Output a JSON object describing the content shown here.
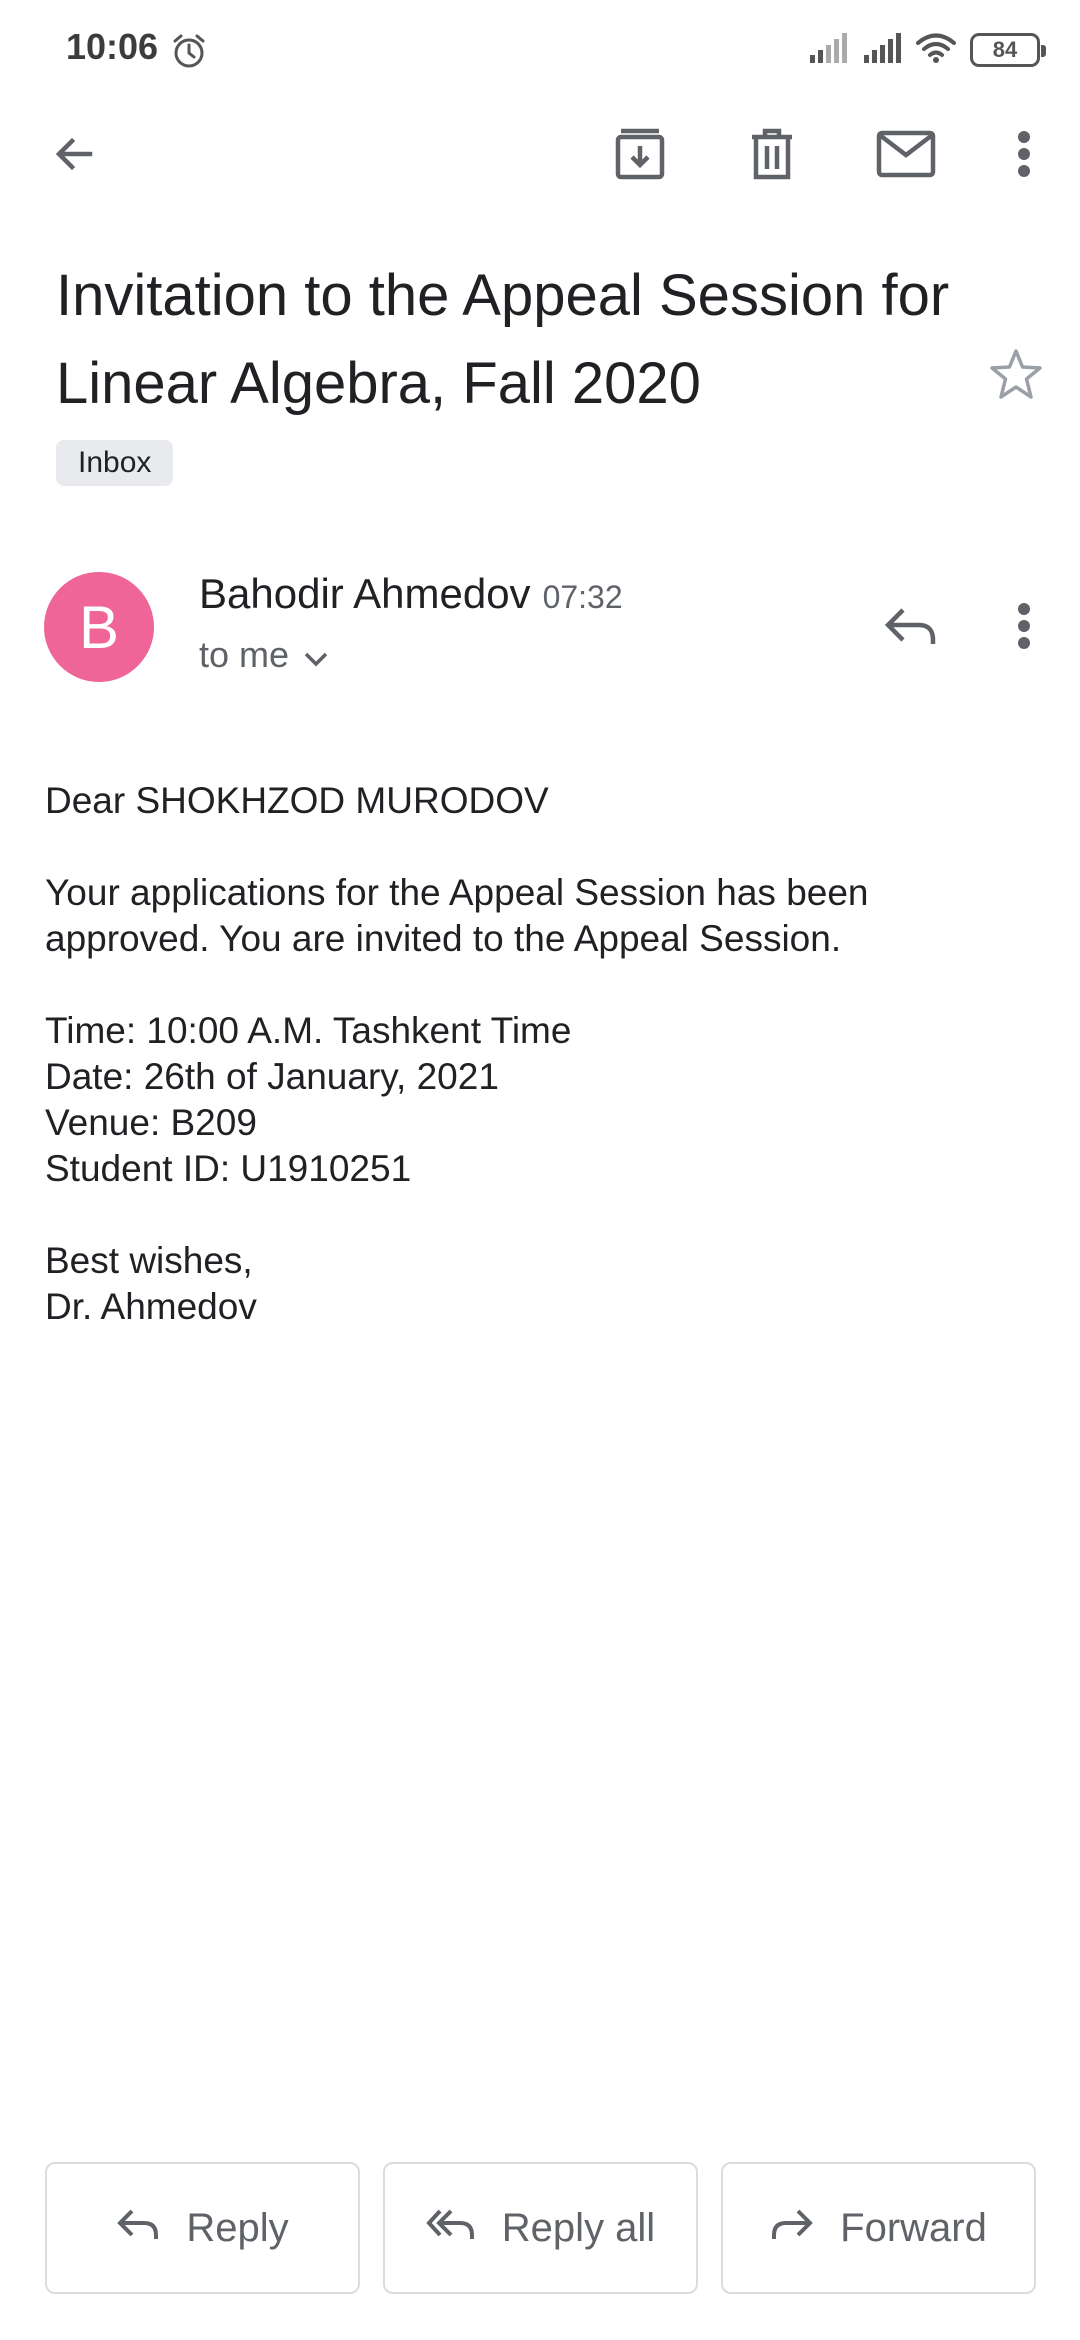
{
  "status_bar": {
    "time": "10:06",
    "battery": "84"
  },
  "toolbar": {
    "back_icon": "arrow-back-icon",
    "archive_icon": "archive-icon",
    "delete_icon": "trash-icon",
    "mark_unread_icon": "mail-icon",
    "more_icon": "more-vert-icon"
  },
  "email": {
    "subject": "Invitation to the Appeal Session for Linear Algebra, Fall 2020",
    "label": "Inbox",
    "sender": {
      "initial": "B",
      "name": "Bahodir Ahmedov",
      "time": "07:32",
      "recipients": "to me",
      "avatar_color": "#ef6597"
    },
    "body": {
      "greeting": "Dear SHOKHZOD MURODOV",
      "paragraph": "Your applications for the Appeal Session has been approved. You are invited to the Appeal Session.",
      "time_line": "Time: 10:00 A.M. Tashkent Time",
      "date_line": "Date: 26th of January, 2021",
      "venue_line": "Venue: B209",
      "student_line": "Student ID: U1910251",
      "closing": "Best wishes,",
      "signature": "Dr. Ahmedov"
    }
  },
  "actions": {
    "reply": "Reply",
    "reply_all": "Reply all",
    "forward": "Forward"
  },
  "colors": {
    "icon_gray": "#5f6368",
    "chip_bg": "#e8eaed",
    "border": "#dadce0"
  }
}
